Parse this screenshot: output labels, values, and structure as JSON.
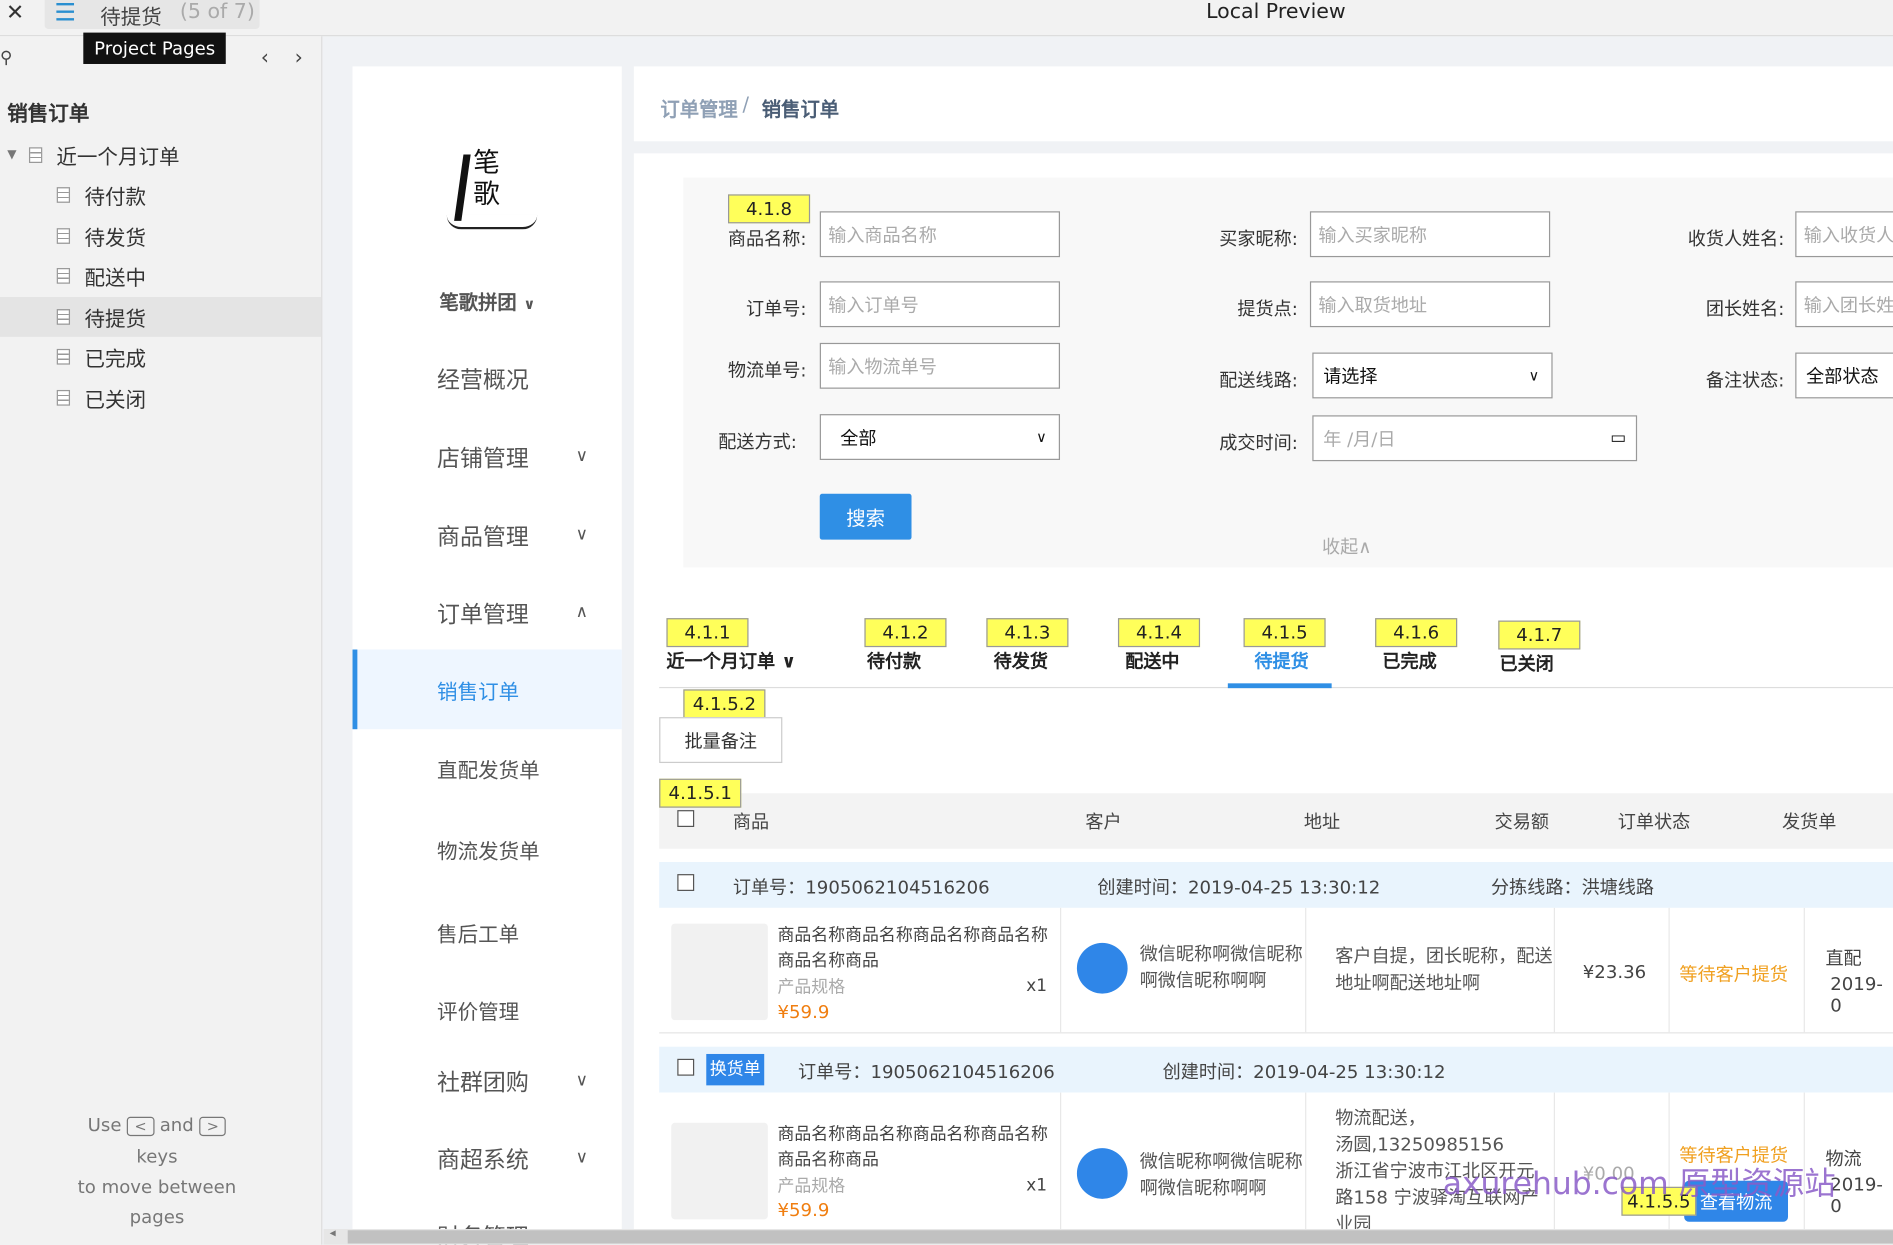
{
  "window": {
    "title": "Local Preview",
    "page_name": "待提货",
    "page_count": "(5 of 7)",
    "tooltip": "Project Pages"
  },
  "pages_panel": {
    "heading": "销售订单",
    "items": [
      {
        "label": "近一个月订单",
        "level": 0,
        "expanded": true
      },
      {
        "label": "待付款",
        "level": 1
      },
      {
        "label": "待发货",
        "level": 1
      },
      {
        "label": "配送中",
        "level": 1
      },
      {
        "label": "待提货",
        "level": 1,
        "selected": true
      },
      {
        "label": "已完成",
        "level": 1
      },
      {
        "label": "已关闭",
        "level": 1
      }
    ],
    "hint": {
      "use": "Use",
      "and": "and",
      "keys": "keys",
      "rest1": "to move between",
      "rest2": "pages",
      "key1": "<",
      "key2": ">"
    }
  },
  "sidebar": {
    "brand": "笔歌拼团",
    "logo_text": "笔歌",
    "items": [
      {
        "label": "经营概况",
        "chevron": ""
      },
      {
        "label": "店铺管理",
        "chevron": "down"
      },
      {
        "label": "商品管理",
        "chevron": "down"
      },
      {
        "label": "订单管理",
        "chevron": "up"
      },
      {
        "label": "销售订单",
        "active": true
      },
      {
        "label": "直配发货单"
      },
      {
        "label": "物流发货单"
      },
      {
        "label": "售后工单"
      },
      {
        "label": "评价管理"
      },
      {
        "label": "社群团购",
        "chevron": "down"
      },
      {
        "label": "商超系统",
        "chevron": "down"
      },
      {
        "label": "财务管理"
      }
    ]
  },
  "breadcrumb": {
    "parent": "订单管理",
    "sep": " / ",
    "current": "销售订单"
  },
  "filters": {
    "product_name": {
      "label": "商品名称:",
      "placeholder": "输入商品名称"
    },
    "buyer_nick": {
      "label": "买家昵称:",
      "placeholder": "输入买家昵称"
    },
    "receiver_name": {
      "label": "收货人姓名:",
      "placeholder": "输入收货人"
    },
    "order_no": {
      "label": "订单号:",
      "placeholder": "输入订单号"
    },
    "pickup_point": {
      "label": "提货点:",
      "placeholder": "输入取货地址"
    },
    "leader_name": {
      "label": "团长姓名:",
      "placeholder": "输入团长姓"
    },
    "logistics_no": {
      "label": "物流单号:",
      "placeholder": "输入物流单号"
    },
    "route": {
      "label": "配送线路:",
      "value": "请选择"
    },
    "remark_status": {
      "label": "备注状态:",
      "value": "全部状态"
    },
    "delivery_method": {
      "label": "配送方式:",
      "value": "全部"
    },
    "deal_time": {
      "label": "成交时间:",
      "placeholder": "年 /月/日"
    },
    "search_button": "搜索",
    "collapse": "收起∧"
  },
  "annotations": {
    "a418": "4.1.8",
    "a411": "4.1.1",
    "a412": "4.1.2",
    "a413": "4.1.3",
    "a414": "4.1.4",
    "a415": "4.1.5",
    "a416": "4.1.6",
    "a417": "4.1.7",
    "a4152": "4.1.5.2",
    "a4151": "4.1.5.1",
    "a4155": "4.1.5.5"
  },
  "tabs": [
    {
      "label": "近一个月订单 ∨"
    },
    {
      "label": "待付款"
    },
    {
      "label": "待发货"
    },
    {
      "label": "配送中"
    },
    {
      "label": "待提货",
      "active": true
    },
    {
      "label": "已完成"
    },
    {
      "label": "已关闭"
    }
  ],
  "batch_remark": "批量备注",
  "table": {
    "columns": [
      "商品",
      "客户",
      "地址",
      "交易额",
      "订单状态",
      "发货单"
    ]
  },
  "orders": [
    {
      "order_no": "订单号：1905062104516206",
      "created": "创建时间：2019-04-25 13:30:12",
      "route": "分拣线路：洪塘线路",
      "product": "商品名称商品名称商品名称商品名称商品名称商品",
      "spec": "产品规格",
      "qty": "x1",
      "price": "¥59.9",
      "customer": "微信昵称啊微信昵称啊微信昵称啊啊",
      "address": "客户自提，团长昵称，配送地址啊配送地址啊",
      "amount": "¥23.36",
      "status": "等待客户提货",
      "ship1": "直配",
      "ship2": "2019-0"
    },
    {
      "badge": "换货单",
      "order_no": "订单号：1905062104516206",
      "created": "创建时间：2019-04-25 13:30:12",
      "product": "商品名称商品名称商品名称商品名称商品名称商品",
      "spec": "产品规格",
      "qty": "x1",
      "price": "¥59.9",
      "customer": "微信昵称啊微信昵称啊微信昵称啊啊",
      "address": "物流配送，\n汤圆,13250985156\n浙江省宁波市江北区开元路158 宁波驿淘互联网产业园",
      "amount": "¥0.00",
      "status": "等待客户提货",
      "action": "查看物流",
      "ship1": "物流",
      "ship2": "2019-0"
    }
  ],
  "watermark": "axurehub.com 原型资源站",
  "colors": {
    "accent": "#2f8fe5",
    "annotation": "#ffff5a",
    "status": "#f0a020",
    "price": "#f07e10"
  }
}
